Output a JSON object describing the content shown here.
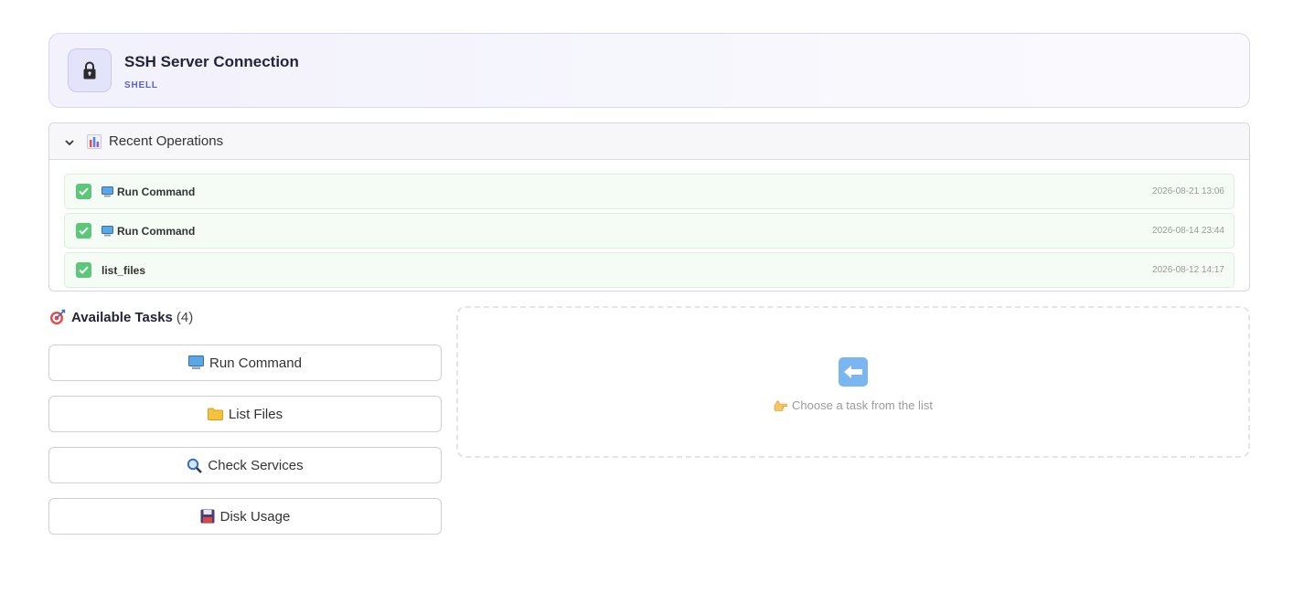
{
  "header": {
    "title": "SSH Server Connection",
    "tag": "SHELL",
    "icon": "lock-icon",
    "accent": "#5b5fc7"
  },
  "recent": {
    "title": "Recent Operations",
    "icon": "bar-chart-icon",
    "expanded": true,
    "items": [
      {
        "label": "Run Command",
        "icon": "computer-icon",
        "time": "2026-08-21 13:06",
        "status": "success"
      },
      {
        "label": "Run Command",
        "icon": "computer-icon",
        "time": "2026-08-14 23:44",
        "status": "success"
      },
      {
        "label": "list_files",
        "icon": "",
        "time": "2026-08-12 14:17",
        "status": "success"
      }
    ]
  },
  "tasks": {
    "title": "Available Tasks",
    "count": "4",
    "icon": "target-icon",
    "items": [
      {
        "label": "Run Command",
        "icon": "computer-icon"
      },
      {
        "label": "List Files",
        "icon": "folder-icon"
      },
      {
        "label": "Check Services",
        "icon": "magnifier-icon"
      },
      {
        "label": "Disk Usage",
        "icon": "floppy-disk-icon"
      }
    ]
  },
  "placeholder": {
    "icon": "left-arrow-icon",
    "hint": "Choose a task from the list",
    "hint_icon": "pointing-hand-icon"
  },
  "colors": {
    "success": "#5cc77a",
    "header_bg": "#f2f1fc"
  }
}
